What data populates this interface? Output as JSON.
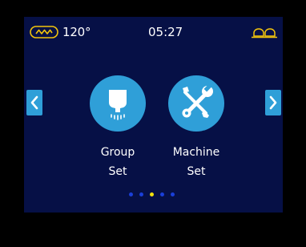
{
  "status_bar": {
    "heater_icon": "heater-icon",
    "temperature": "120°",
    "time": "05:27",
    "cup_icon": "cup-icon"
  },
  "navigation": {
    "prev_icon": "chevron-left-icon",
    "next_icon": "chevron-right-icon"
  },
  "menu": {
    "tiles": [
      {
        "icon": "brew-group-icon",
        "label_line1": "Group",
        "label_line2": "Set"
      },
      {
        "icon": "wrench-screwdriver-icon",
        "label_line1": "Machine",
        "label_line2": "Set"
      }
    ]
  },
  "pagination": {
    "total": 5,
    "active_index": 2
  },
  "colors": {
    "background": "#061046",
    "accent": "#2f9fd8",
    "status_icon": "#f2c40c",
    "active_dot": "#f2e00c",
    "inactive_dot": "#1a3fd8"
  }
}
